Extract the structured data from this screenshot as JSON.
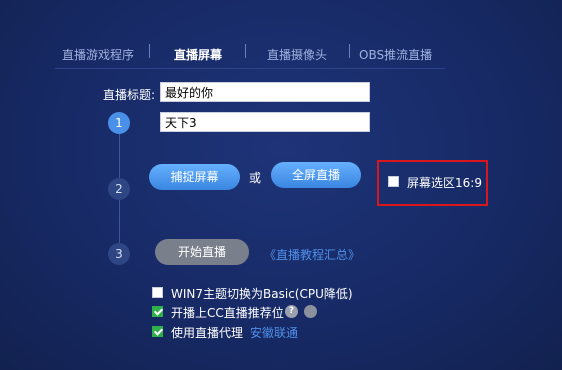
{
  "tabs": [
    {
      "label": "直播游戏程序",
      "active": false
    },
    {
      "label": "直播屏幕",
      "active": true
    },
    {
      "label": "直播摄像头",
      "active": false
    },
    {
      "label": "OBS推流直播",
      "active": false
    }
  ],
  "form": {
    "title_label": "直播标题:",
    "title_value": "最好的你",
    "subtitle_value": "天下3"
  },
  "steps": [
    "1",
    "2",
    "3"
  ],
  "buttons": {
    "capture_screen": "捕捉屏幕",
    "or": "或",
    "fullscreen_live": "全屏直播",
    "start_live": "开始直播"
  },
  "tutorial_link": "《直播教程汇总》",
  "screen_16_9": {
    "label": "屏幕选区16:9",
    "checked": false
  },
  "options": [
    {
      "label": "WIN7主题切换为Basic(CPU降低)",
      "checked": false
    },
    {
      "label": "开播上CC直播推荐位",
      "checked": true
    },
    {
      "label": "使用直播代理",
      "checked": true
    }
  ],
  "proxy_link": "安徽联通",
  "colors": {
    "accent": "#4a90e8",
    "highlight_border": "#d9161c",
    "check_green": "#2fb04a"
  }
}
